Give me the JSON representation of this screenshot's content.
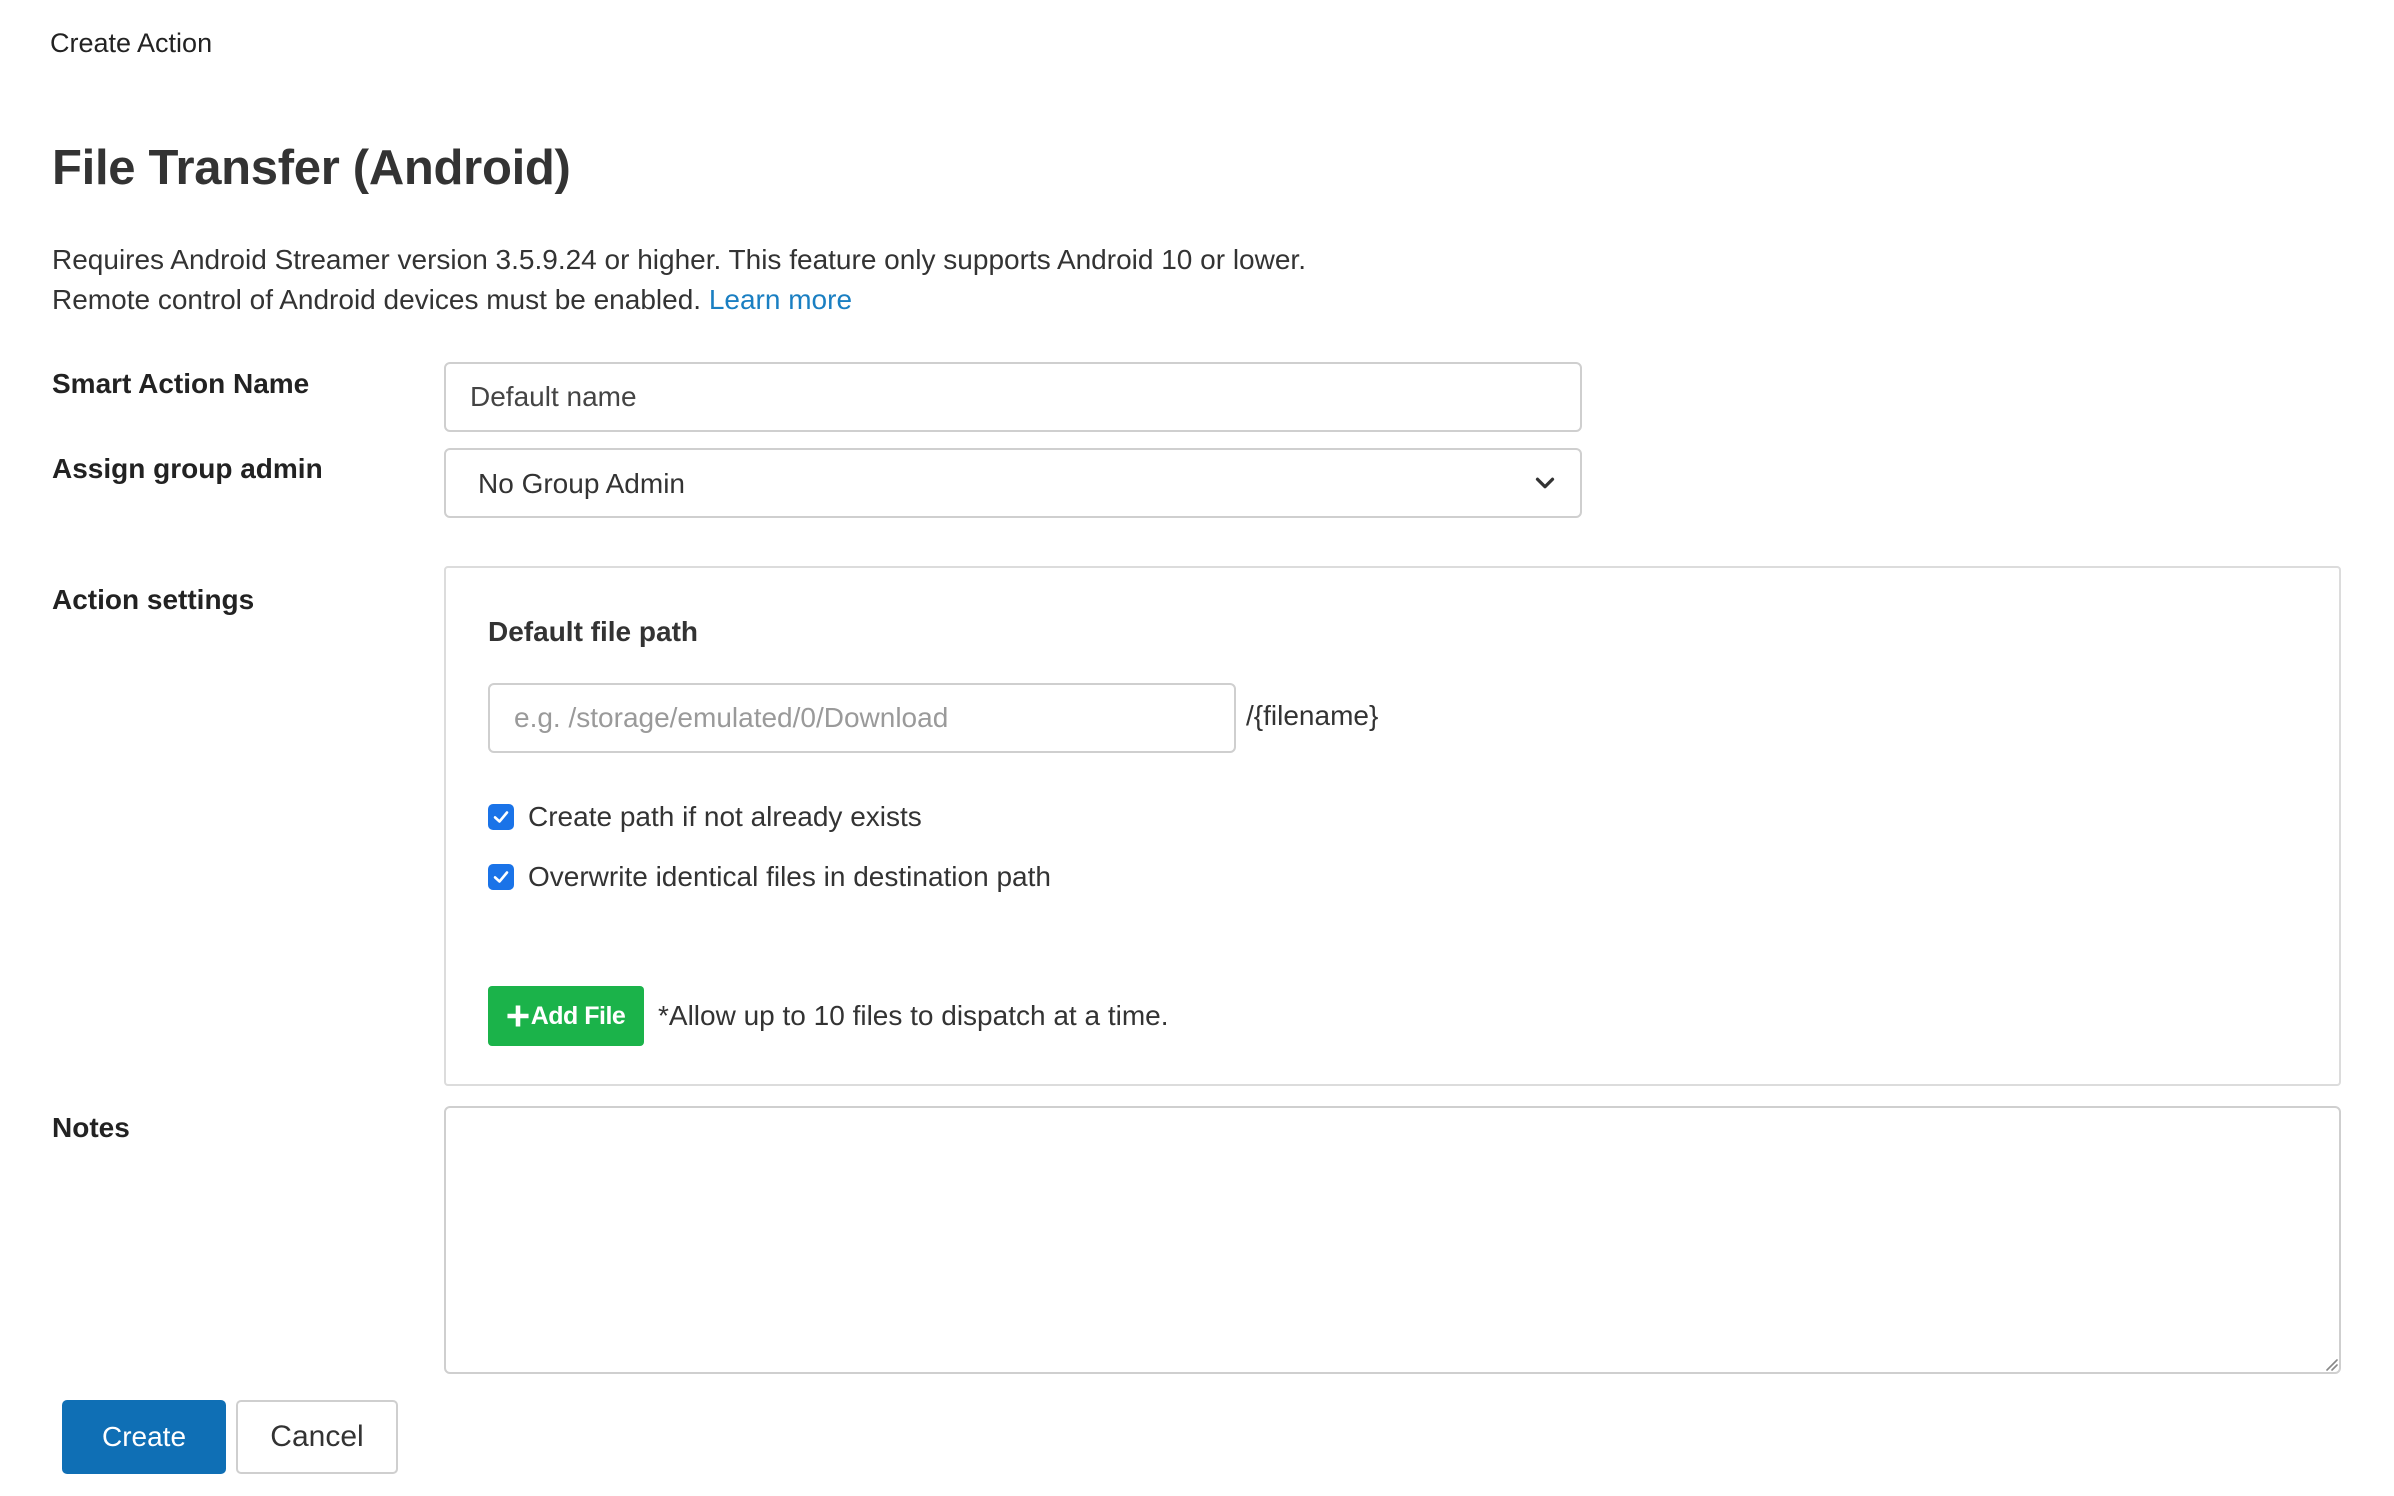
{
  "breadcrumb": "Create Action",
  "title": "File Transfer (Android)",
  "description": {
    "line1": "Requires Android Streamer version 3.5.9.24 or higher. This feature only supports Android 10 or lower.",
    "line2": "Remote control of Android devices must be enabled.",
    "link": "Learn more"
  },
  "form": {
    "smart_action_name": {
      "label": "Smart Action Name",
      "value": "Default name"
    },
    "group_admin": {
      "label": "Assign group admin",
      "selected": "No Group Admin",
      "icon": "chevron-down-icon"
    },
    "action_settings": {
      "label": "Action settings",
      "heading": "Default file path",
      "path_placeholder": "e.g. /storage/emulated/0/Download",
      "path_suffix": "/{filename}",
      "options": [
        {
          "label": "Create path if not already exists",
          "checked": true
        },
        {
          "label": "Overwrite identical files in destination path",
          "checked": true
        }
      ],
      "add_file_label": "Add File",
      "add_file_icon": "plus-icon",
      "add_file_note": "*Allow up to 10 files to dispatch at a time."
    },
    "notes": {
      "label": "Notes",
      "value": ""
    }
  },
  "buttons": {
    "create": "Create",
    "cancel": "Cancel"
  },
  "colors": {
    "link": "#1a7fc2",
    "checkbox": "#1a73e8",
    "add_file": "#1bb34a",
    "primary": "#0f6fb5"
  }
}
